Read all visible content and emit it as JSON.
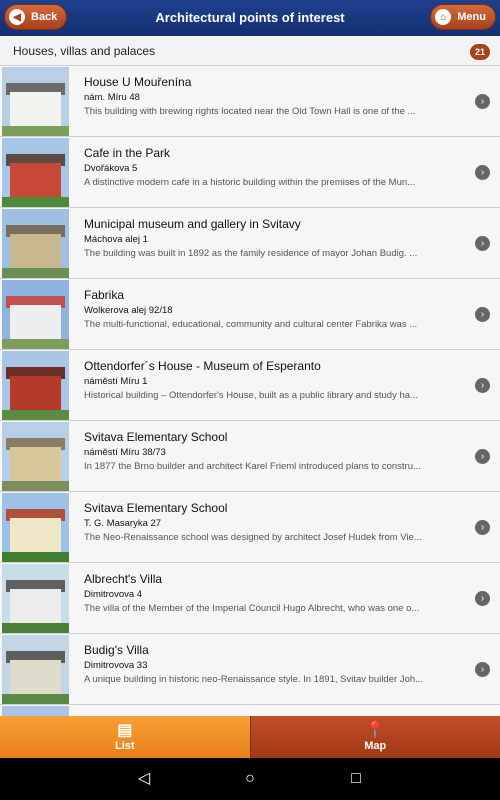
{
  "header": {
    "back_label": "Back",
    "title": "Architectural points of interest",
    "menu_label": "Menu"
  },
  "section": {
    "title": "Houses, villas and palaces",
    "count": "21"
  },
  "items": [
    {
      "name": "House U Mouřenína",
      "address": "nám. Míru 48",
      "description": "This building with brewing rights located near the Old Town Hall is one of the ..."
    },
    {
      "name": "Cafe in the Park",
      "address": "Dvořákova 5",
      "description": "A distinctive modern cafe in a historic building within the premises of the Mun..."
    },
    {
      "name": "Municipal museum and gallery in Svitavy",
      "address": "Máchova alej 1",
      "description": "The building was built in 1892 as the family residence of mayor Johan Budig. ..."
    },
    {
      "name": "Fabrika",
      "address": "Wolkerova alej 92/18",
      "description": "The multi-functional, educational, community and cultural center Fabrika was ..."
    },
    {
      "name": "Ottendorfer´s House - Museum of Esperanto",
      "address": "náměstí Míru 1",
      "description": "Historical building – Ottendorfer's House, built as a public library and study ha..."
    },
    {
      "name": "Svitava Elementary School",
      "address": "náměstí Míru 38/73",
      "description": "In 1877 the Brno builder and architect Karel Frieml introduced plans to constru..."
    },
    {
      "name": "Svitava Elementary School",
      "address": "T. G. Masaryka 27",
      "description": "The Neo-Renaissance school was designed by architect Josef Hudek from Vie..."
    },
    {
      "name": "Albrecht's Villa",
      "address": "Dimitrovova 4",
      "description": "The villa of the Member of the Imperial Council Hugo Albrecht, who was one o..."
    },
    {
      "name": "Budig's Villa",
      "address": "Dimitrovova 33",
      "description": "A unique building in historic neo-Renaissance style. In 1891, Svitav builder Joh..."
    }
  ],
  "tabs": {
    "list_label": "List",
    "map_label": "Map"
  },
  "colors": {
    "header_blue": "#1f3f8f",
    "accent_orange": "#e8801a",
    "accent_rust": "#a8421c"
  },
  "icons": {
    "back": "chevron-left-icon",
    "menu": "home-icon",
    "row": "chevron-right-icon",
    "list_tab": "list-icon",
    "map_tab": "map-pin-icon"
  }
}
